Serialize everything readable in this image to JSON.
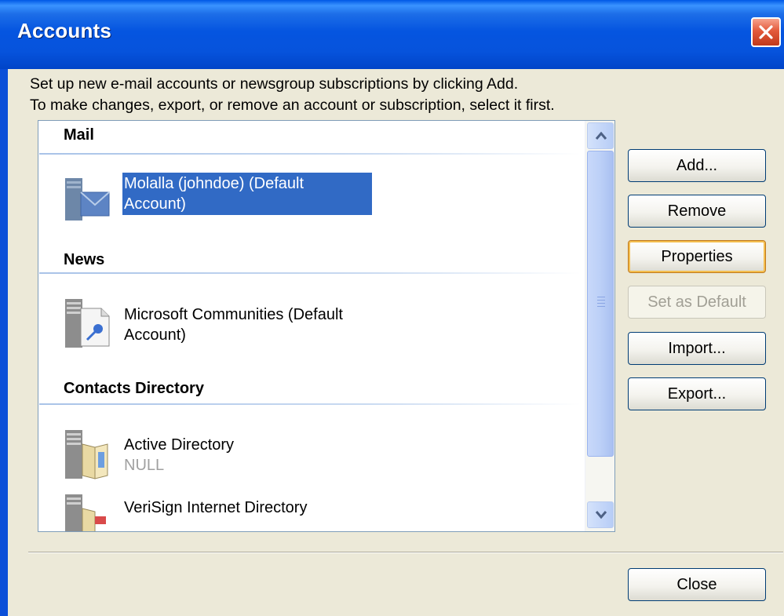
{
  "window": {
    "title": "Accounts"
  },
  "instructions": {
    "line1": "Set up new e-mail accounts or newsgroup subscriptions by clicking Add.",
    "line2": "To make changes, export, or remove an account or subscription, select it first."
  },
  "groups": [
    {
      "header": "Mail",
      "accounts": [
        {
          "line1": "Molalla (johndoe) (Default",
          "line2": "Account)",
          "selected": true,
          "icon": "mail-server-icon"
        }
      ]
    },
    {
      "header": "News",
      "accounts": [
        {
          "line1": "Microsoft Communities (Default",
          "line2": "Account)",
          "selected": false,
          "icon": "news-server-icon"
        }
      ]
    },
    {
      "header": "Contacts Directory",
      "accounts": [
        {
          "line1": "Active Directory",
          "line2": "NULL",
          "selected": false,
          "icon": "directory-server-icon"
        },
        {
          "line1": "VeriSign Internet Directory",
          "line2": "",
          "selected": false,
          "icon": "directory-server-icon"
        }
      ]
    }
  ],
  "buttons": {
    "add": "Add...",
    "remove": "Remove",
    "properties": "Properties",
    "set_default": "Set as Default",
    "import": "Import...",
    "export": "Export...",
    "close": "Close"
  },
  "colors": {
    "selection": "#316ac5",
    "titlebar": "#0555e0",
    "dialog_bg": "#ece9d8"
  }
}
